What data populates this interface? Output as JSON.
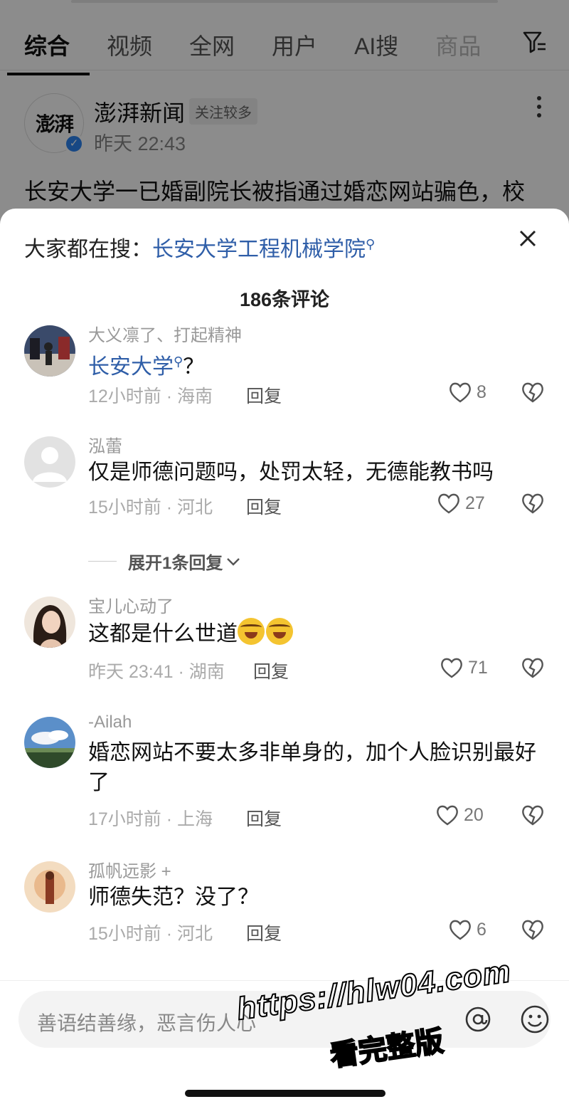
{
  "tabs": [
    "综合",
    "视频",
    "全网",
    "用户",
    "AI搜",
    "商品"
  ],
  "post": {
    "avatar_text": "澎湃",
    "author": "澎湃新闻",
    "badge": "关注较多",
    "time": "昨天 22:43",
    "title": "长安大学一已婚副院长被指通过婚恋网站骗色，校"
  },
  "sheet": {
    "hint_prefix": "大家都在搜：",
    "hint_link": "长安大学工程机械学院",
    "count": "186条评论",
    "reply_label": "回复"
  },
  "comments": [
    {
      "name": "大义凛了、打起精神",
      "text_link": "长安大学",
      "text_suffix": "？",
      "meta": "12小时前 · 海南",
      "likes": "8"
    },
    {
      "name": "泓蕾",
      "text": "仅是师德问题吗，处罚太轻，无德能教书吗",
      "meta": "15小时前 · 河北",
      "likes": "27"
    },
    {
      "name": "宝儿心动了",
      "text": "这都是什么世道",
      "meta": "昨天 23:41 · 湖南",
      "likes": "71"
    },
    {
      "name": "-Ailah",
      "text": "婚恋网站不要太多非单身的，加个人脸识别最好了",
      "meta": "17小时前 · 上海",
      "likes": "20"
    },
    {
      "name": "孤帆远影 +",
      "text": "师德失范？没了？",
      "meta": "15小时前 · 河北",
      "likes": "6"
    }
  ],
  "expand_reply": "展开1条回复",
  "input": {
    "placeholder": "善语结善缘，恶言伤人心"
  },
  "watermark": {
    "line1": "https://hlw04.com",
    "line2": "看完整版"
  }
}
